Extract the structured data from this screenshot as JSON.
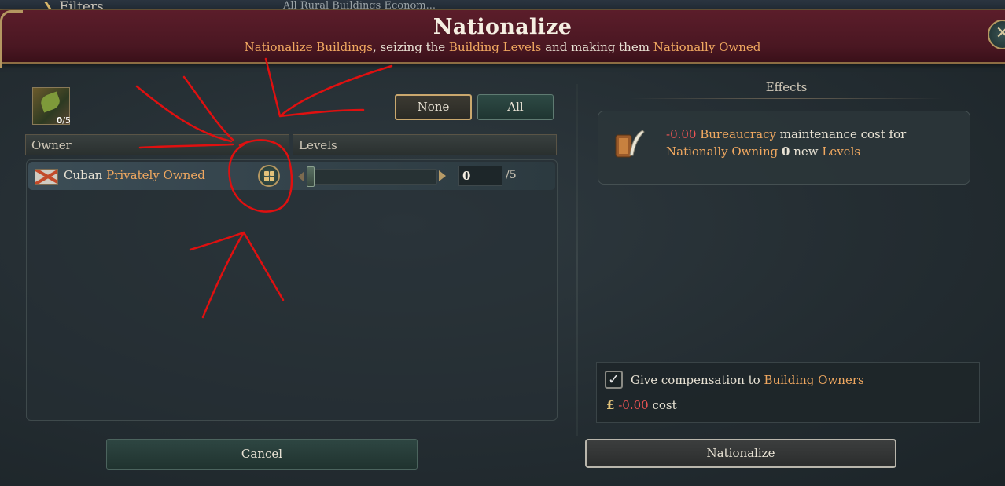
{
  "background": {
    "filters_label": "Filters",
    "behind_text": "All Rural Buildings   Econom..."
  },
  "dialog": {
    "title": "Nationalize",
    "subtitle": {
      "p1": "Nationalize Buildings",
      "p2": ", seizing the ",
      "p3": "Building Levels",
      "p4": " and making them ",
      "p5": "Nationally Owned"
    },
    "close_icon": "close-icon"
  },
  "building": {
    "icon": "plantation-icon",
    "count_selected": "0",
    "count_total": "/5"
  },
  "selection_buttons": {
    "none_label": "None",
    "all_label": "All"
  },
  "columns": {
    "owner": "Owner",
    "levels": "Levels"
  },
  "owners": [
    {
      "flag": "cuba-flag-icon",
      "nationality": "Cuban",
      "type": "Privately Owned",
      "level_value": "0",
      "level_max": "/5"
    }
  ],
  "effects": {
    "title": "Effects",
    "item": {
      "value": "-0.00",
      "p1": "Bureaucracy",
      "p2": " maintenance cost for ",
      "p3": "Nationally Owning",
      "p4": "0",
      "p5": " new ",
      "p6": "Levels"
    }
  },
  "compensation": {
    "checked": true,
    "label_p1": "Give compensation to ",
    "label_p2": "Building Owners",
    "currency": "£",
    "cost_value": "-0.00",
    "cost_label": " cost"
  },
  "footer": {
    "cancel_label": "Cancel",
    "nationalize_label": "Nationalize"
  },
  "colors": {
    "highlight": "#f0a860",
    "negative": "#f05555",
    "header": "#4a1722",
    "annotation": "#e01010"
  }
}
